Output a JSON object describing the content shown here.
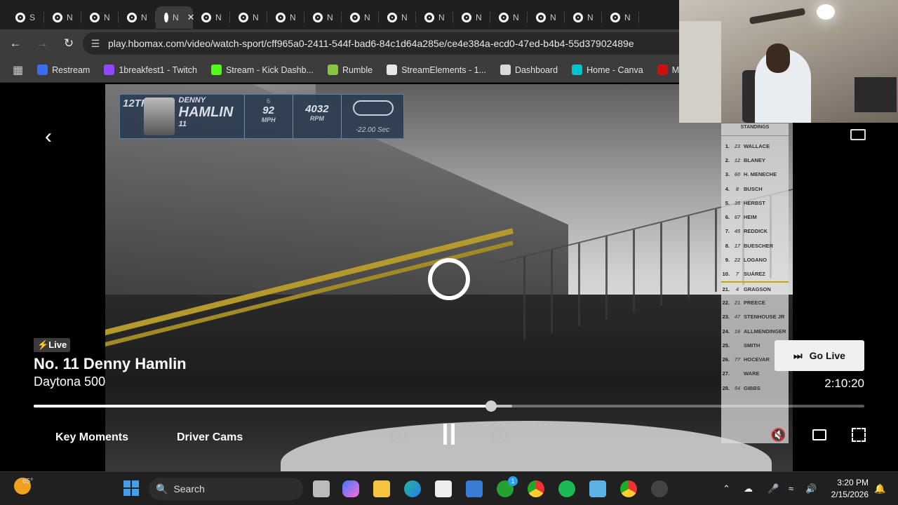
{
  "browser": {
    "tabs": [
      {
        "label": "S"
      },
      {
        "label": "N"
      },
      {
        "label": "N"
      },
      {
        "label": "N"
      },
      {
        "label": "N",
        "active": true,
        "close": "✕"
      },
      {
        "label": "N"
      },
      {
        "label": "N"
      },
      {
        "label": "N"
      },
      {
        "label": "N"
      },
      {
        "label": "N"
      },
      {
        "label": "N"
      },
      {
        "label": "N"
      },
      {
        "label": "N"
      },
      {
        "label": "N"
      },
      {
        "label": "N"
      },
      {
        "label": "N"
      },
      {
        "label": "N"
      }
    ],
    "url": "play.hbomax.com/video/watch-sport/cff965a0-2411-544f-bad6-84c1d64a285e/ce4e384a-ecd0-47ed-b4b4-55d37902489e",
    "bookmarks": [
      {
        "label": "Restream",
        "color": "#3b6cf6"
      },
      {
        "label": "1breakfest1 - Twitch",
        "color": "#9146ff"
      },
      {
        "label": "Stream - Kick Dashb...",
        "color": "#53fc18"
      },
      {
        "label": "Rumble",
        "color": "#85c742"
      },
      {
        "label": "StreamElements - 1...",
        "color": "#e8e8e8"
      },
      {
        "label": "Dashboard",
        "color": "#d9d9d9"
      },
      {
        "label": "Home - Canva",
        "color": "#00c4cc"
      },
      {
        "label": "Myinstants",
        "color": "#d01010"
      }
    ]
  },
  "hud": {
    "position": "12TH",
    "first_name": "DENNY",
    "last_name": "HAMLIN",
    "car_number": "11",
    "gear": "6",
    "speed": "92",
    "speed_unit": "MPH",
    "rpm": "4032",
    "rpm_unit": "RPM",
    "interval": "-22.00 Sec"
  },
  "standings": {
    "header": "STANDINGS",
    "rows": [
      {
        "pos": "1.",
        "car": "23",
        "name": "WALLACE"
      },
      {
        "pos": "2.",
        "car": "12",
        "name": "BLANEY"
      },
      {
        "pos": "3.",
        "car": "60",
        "name": "H. MENECHE"
      },
      {
        "pos": "4.",
        "car": "8",
        "name": "BUSCH"
      },
      {
        "pos": "5.",
        "car": "35",
        "name": "HERBST"
      },
      {
        "pos": "6.",
        "car": "67",
        "name": "HEIM"
      },
      {
        "pos": "7.",
        "car": "45",
        "name": "REDDICK"
      },
      {
        "pos": "8.",
        "car": "17",
        "name": "BUESCHER"
      },
      {
        "pos": "9.",
        "car": "22",
        "name": "LOGANO"
      },
      {
        "pos": "10.",
        "car": "7",
        "name": "SUÁREZ"
      },
      {
        "pos": "21.",
        "car": "4",
        "name": "GRAGSON",
        "sep": true
      },
      {
        "pos": "22.",
        "car": "21",
        "name": "PREECE"
      },
      {
        "pos": "23.",
        "car": "47",
        "name": "STENHOUSE JR"
      },
      {
        "pos": "24.",
        "car": "16",
        "name": "ALLMENDINGER"
      },
      {
        "pos": "25.",
        "car": "",
        "name": "SMITH"
      },
      {
        "pos": "26.",
        "car": "77",
        "name": "HOCEVAR"
      },
      {
        "pos": "27.",
        "car": "",
        "name": "WARE"
      },
      {
        "pos": "28.",
        "car": "54",
        "name": "GIBBS"
      }
    ]
  },
  "player": {
    "live_label": "Live",
    "title": "No. 11 Denny Hamlin",
    "subtitle": "Daytona 500",
    "go_live_label": "Go Live",
    "time": "2:10:20",
    "progress": 0.551,
    "buffered": 0.576,
    "key_moments_label": "Key Moments",
    "driver_cams_label": "Driver Cams",
    "rewind_label": "10",
    "forward_label": "10"
  },
  "taskbar": {
    "weather_temp": "65°",
    "search_label": "Search",
    "xbox_badge": "1",
    "time": "3:20 PM",
    "date": "2/15/2026"
  },
  "icons": {
    "back": "‹",
    "mute": "🔇",
    "search": "🔍"
  }
}
